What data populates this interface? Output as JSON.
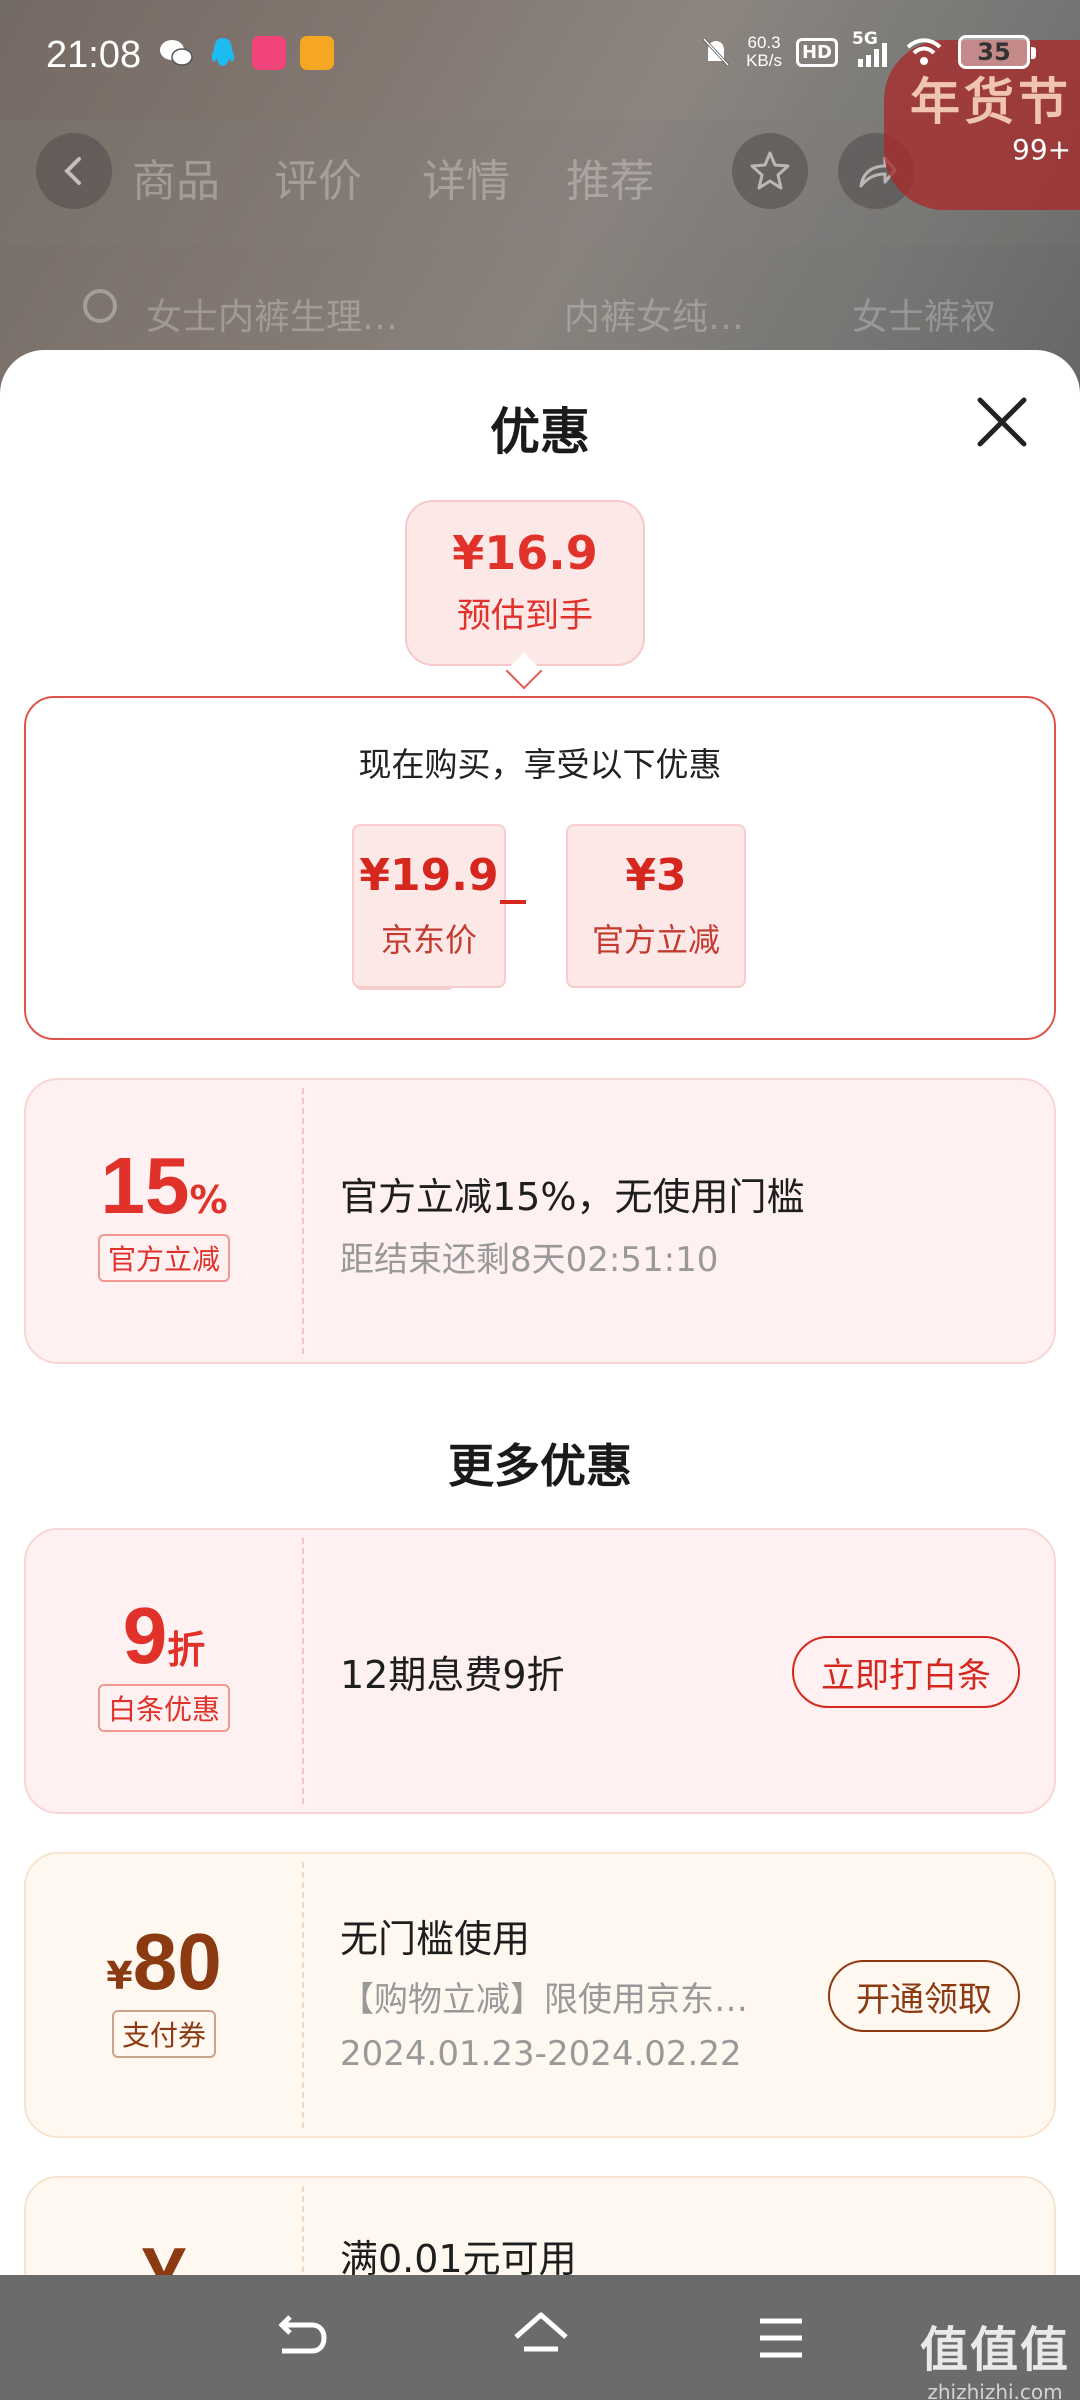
{
  "status_bar": {
    "time": "21:08",
    "net_speed_value": "60.3",
    "net_speed_unit": "KB/s",
    "hd": "HD",
    "network": "5G",
    "battery": "35"
  },
  "background": {
    "tabs": [
      "商品",
      "评价",
      "详情",
      "推荐"
    ],
    "search_chips": [
      "女士内裤生理…",
      "内裤女纯…",
      "女士裤衩"
    ],
    "promo_text": "年货节",
    "promo_count": "99+"
  },
  "sheet": {
    "title": "优惠",
    "estimate": {
      "price": "¥16.9",
      "label": "预估到手"
    },
    "buy_now": {
      "heading": "现在购买，享受以下优惠",
      "items": [
        {
          "value": "¥19.9",
          "label": "京东价"
        },
        {
          "value": "¥3",
          "label": "官方立减"
        }
      ]
    },
    "official_coupon": {
      "big": "15",
      "suffix": "%",
      "tag": "官方立减",
      "title": "官方立减15%，无使用门槛",
      "countdown": "距结束还剩8天02:51:10"
    },
    "more_title": "更多优惠",
    "baitiao_coupon": {
      "big": "9",
      "suffix": "折",
      "tag": "白条优惠",
      "title": "12期息费9折",
      "button": "立即打白条"
    },
    "pay_coupon": {
      "prefix": "¥",
      "big": "80",
      "tag": "支付券",
      "title": "无门槛使用",
      "desc": "【购物立减】限使用京东…",
      "validity": "2024.01.23-2024.02.22",
      "button": "开通领取"
    },
    "partial_coupon": {
      "big": "¥",
      "title": "满0.01元可用"
    }
  },
  "watermark": {
    "big": "值值值",
    "small": "zhizhizhi.com"
  },
  "colors": {
    "accent_red": "#e0322a",
    "brown": "#8b3a12",
    "nav_bar": "#6b6b6b"
  }
}
